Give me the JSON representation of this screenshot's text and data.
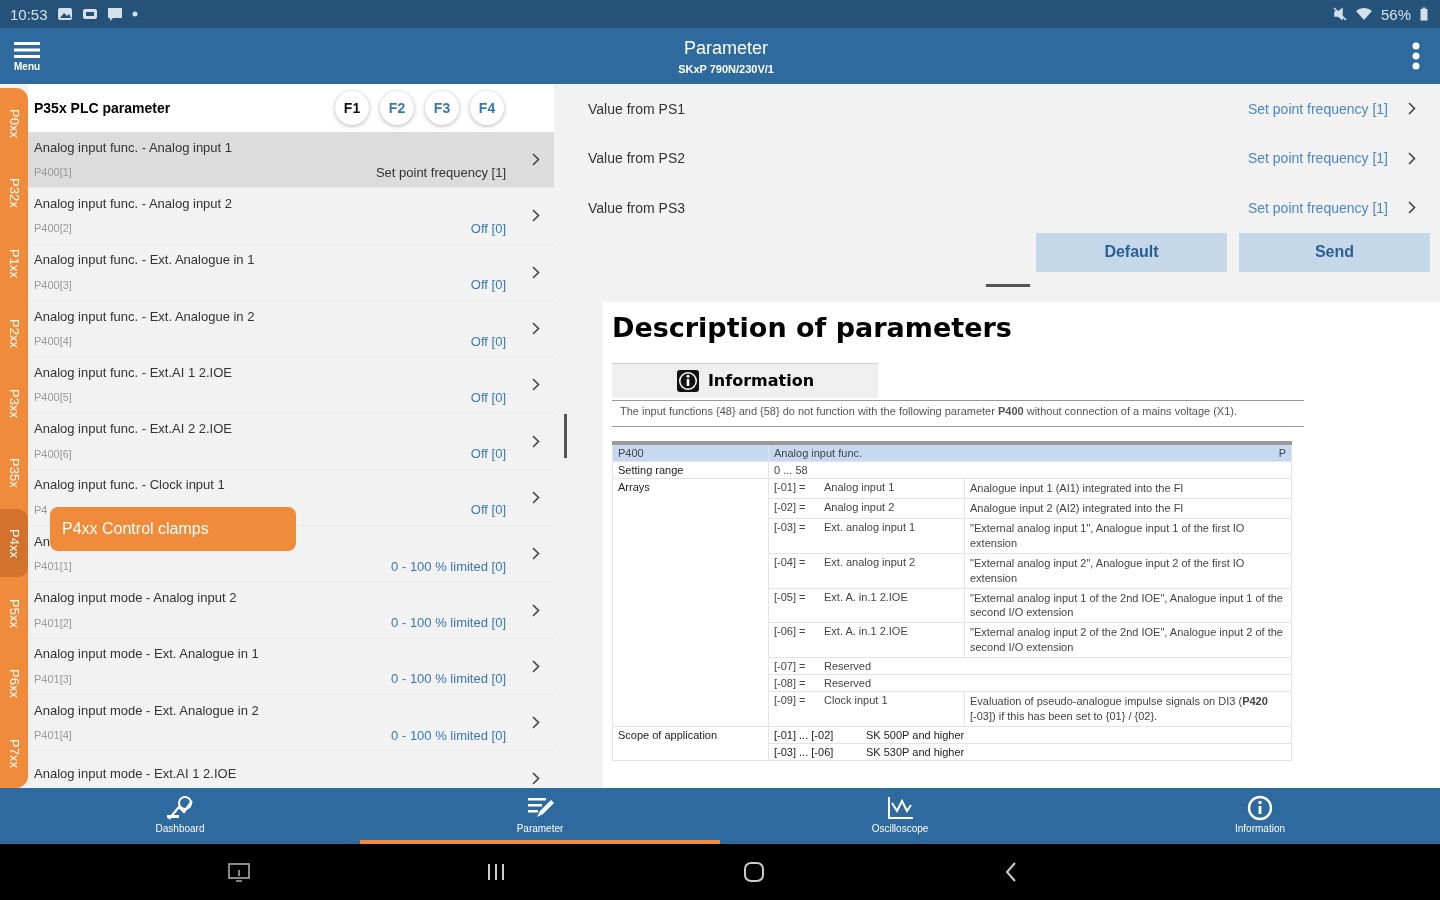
{
  "status_bar": {
    "time": "10:53",
    "battery": "56%"
  },
  "app_bar": {
    "menu_label": "Menu",
    "title": "Parameter",
    "subtitle": "SKxP 790N/230V/1"
  },
  "side_tabs": [
    {
      "label": "P0xx",
      "selected": false
    },
    {
      "label": "P32x",
      "selected": false
    },
    {
      "label": "P1xx",
      "selected": false
    },
    {
      "label": "P2xx",
      "selected": false
    },
    {
      "label": "P3xx",
      "selected": false
    },
    {
      "label": "P35x",
      "selected": false
    },
    {
      "label": "P4xx",
      "selected": true
    },
    {
      "label": "P5xx",
      "selected": false
    },
    {
      "label": "P6xx",
      "selected": false
    },
    {
      "label": "P7xx",
      "selected": false
    }
  ],
  "group_popup": "P4xx Control clamps",
  "list_header": {
    "title": "P35x PLC parameter",
    "sets": [
      {
        "label": "F1",
        "selected": true
      },
      {
        "label": "F2",
        "selected": false
      },
      {
        "label": "F3",
        "selected": false
      },
      {
        "label": "F4",
        "selected": false
      }
    ]
  },
  "parameters": [
    {
      "name": "Analog input func. - Analog input 1",
      "code": "P400[1]",
      "value": "Set point frequency [1]",
      "selected": true
    },
    {
      "name": "Analog input func. - Analog input 2",
      "code": "P400[2]",
      "value": "Off [0]",
      "selected": false
    },
    {
      "name": "Analog input func. - Ext. Analogue in 1",
      "code": "P400[3]",
      "value": "Off [0]",
      "selected": false
    },
    {
      "name": "Analog input func. - Ext. Analogue in 2",
      "code": "P400[4]",
      "value": "Off [0]",
      "selected": false
    },
    {
      "name": "Analog input func. - Ext.AI 1 2.IOE",
      "code": "P400[5]",
      "value": "Off [0]",
      "selected": false
    },
    {
      "name": "Analog input func. - Ext.AI 2 2.IOE",
      "code": "P400[6]",
      "value": "Off [0]",
      "selected": false
    },
    {
      "name": "Analog input func. - Clock input 1",
      "code": "P4",
      "value": "Off [0]",
      "selected": false
    },
    {
      "name": "An",
      "code": "P401[1]",
      "value": "0 - 100 % limited [0]",
      "selected": false
    },
    {
      "name": "Analog input mode - Analog input 2",
      "code": "P401[2]",
      "value": "0 - 100 % limited [0]",
      "selected": false
    },
    {
      "name": "Analog input mode - Ext. Analogue in 1",
      "code": "P401[3]",
      "value": "0 - 100 % limited [0]",
      "selected": false
    },
    {
      "name": "Analog input mode - Ext. Analogue in 2",
      "code": "P401[4]",
      "value": "0 - 100 % limited [0]",
      "selected": false
    },
    {
      "name": "Analog input mode - Ext.AI 1 2.IOE",
      "selected": false
    }
  ],
  "settings": [
    {
      "label": "Value from PS1",
      "value": "Set point frequency [1]"
    },
    {
      "label": "Value from PS2",
      "value": "Set point frequency [1]"
    },
    {
      "label": "Value from PS3",
      "value": "Set point frequency [1]"
    }
  ],
  "buttons": [
    "Default",
    "Send"
  ],
  "description": {
    "title": "Description of parameters",
    "info_title": "Information",
    "info_text": "The input functions {48} and {58} do not function with the following parameter **P400** without connection of a mains voltage (X1).",
    "table": {
      "header": [
        "P400",
        "Analog input func.",
        "P"
      ],
      "setting_range": {
        "label": "Setting range",
        "value": "0 ... 58"
      },
      "arrays_label": "Arrays",
      "arrays": [
        {
          "index": "[-01] =",
          "name": "Analog input 1",
          "text": "Analogue input 1 (AI1) integrated into the FI"
        },
        {
          "index": "[-02] =",
          "name": "Analog input 2",
          "text": "Analogue input 2 (AI2) integrated into the FI"
        },
        {
          "index": "[-03] =",
          "name": "Ext. analog input 1",
          "text": "\"External analog input 1\", Analogue input 1 of the first IO extension"
        },
        {
          "index": "[-04] =",
          "name": "Ext. analog input 2",
          "text": "\"External analog input 2\", Analogue input 2 of the first IO extension"
        },
        {
          "index": "[-05] =",
          "name": "Ext. A. in.1 2.IOE",
          "text": "\"External analog input 1 of the 2nd IOE\", Analogue input 1 of the second I/O extension"
        },
        {
          "index": "[-06] =",
          "name": "Ext. A. in.1 2.IOE",
          "text": "\"External analog input 2 of the 2nd IOE\", Analogue input 2 of the second I/O extension"
        },
        {
          "index": "[-07] =",
          "name": "Reserved"
        },
        {
          "index": "[-08] =",
          "name": "Reserved"
        },
        {
          "index": "[-09] =",
          "name": "Clock input 1",
          "text": "Evaluation of pseudo-analogue impulse signals on DI3 (**P420** [-03]) if this has been set to {01} / {02}."
        }
      ],
      "scope_label": "Scope of application",
      "scope": [
        {
          "range": "[-01] ... [-02]",
          "text": "SK 500P and higher"
        },
        {
          "range": "[-03] ... [-06]",
          "text": "SK 530P and higher"
        }
      ]
    }
  },
  "bottom_nav": [
    {
      "label": "Dashboard",
      "selected": false
    },
    {
      "label": "Parameter",
      "selected": true
    },
    {
      "label": "Oscilloscope",
      "selected": false
    },
    {
      "label": "Information",
      "selected": false
    }
  ]
}
